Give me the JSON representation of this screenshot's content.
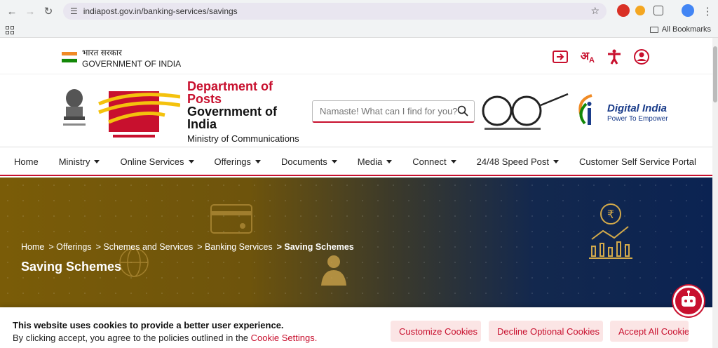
{
  "browser": {
    "url": "indiapost.gov.in/banking-services/savings",
    "bookmarks_label": "All Bookmarks"
  },
  "gov": {
    "hindi": "भारत सरकार",
    "english": "GOVERNMENT OF INDIA"
  },
  "header": {
    "dept_line1": "Department of",
    "dept_line2": "Posts",
    "gov_line1": "Government of",
    "gov_line2": "India",
    "ministry": "Ministry of Communications",
    "search_placeholder": "Namaste! What can I find for you?",
    "digital_title": "Digital India",
    "digital_sub": "Power To Empower"
  },
  "menu": [
    {
      "label": "Home",
      "dropdown": false
    },
    {
      "label": "Ministry",
      "dropdown": true
    },
    {
      "label": "Online Services",
      "dropdown": true
    },
    {
      "label": "Offerings",
      "dropdown": true
    },
    {
      "label": "Documents",
      "dropdown": true
    },
    {
      "label": "Media",
      "dropdown": true
    },
    {
      "label": "Connect",
      "dropdown": true
    },
    {
      "label": "24/48 Speed Post",
      "dropdown": true
    },
    {
      "label": "Customer Self Service Portal",
      "dropdown": false
    }
  ],
  "breadcrumb": {
    "home": "Home",
    "offerings": "> Offerings",
    "schemes": "> Schemes and Services",
    "banking": "> Banking Services",
    "current": "> Saving Schemes"
  },
  "banner": {
    "title": "Saving Schemes"
  },
  "cookie": {
    "heading": "This website uses cookies to provide a better user experience.",
    "text": "By clicking accept, you agree to the policies outlined in the",
    "link": "Cookie Settings.",
    "customize": "Customize Cookies",
    "decline": "Decline Optional Cookies",
    "accept": "Accept All Cookies"
  },
  "colors": {
    "brand_red": "#c8102e",
    "banner_gold": "#7a5c08",
    "banner_navy": "#0b2352"
  }
}
